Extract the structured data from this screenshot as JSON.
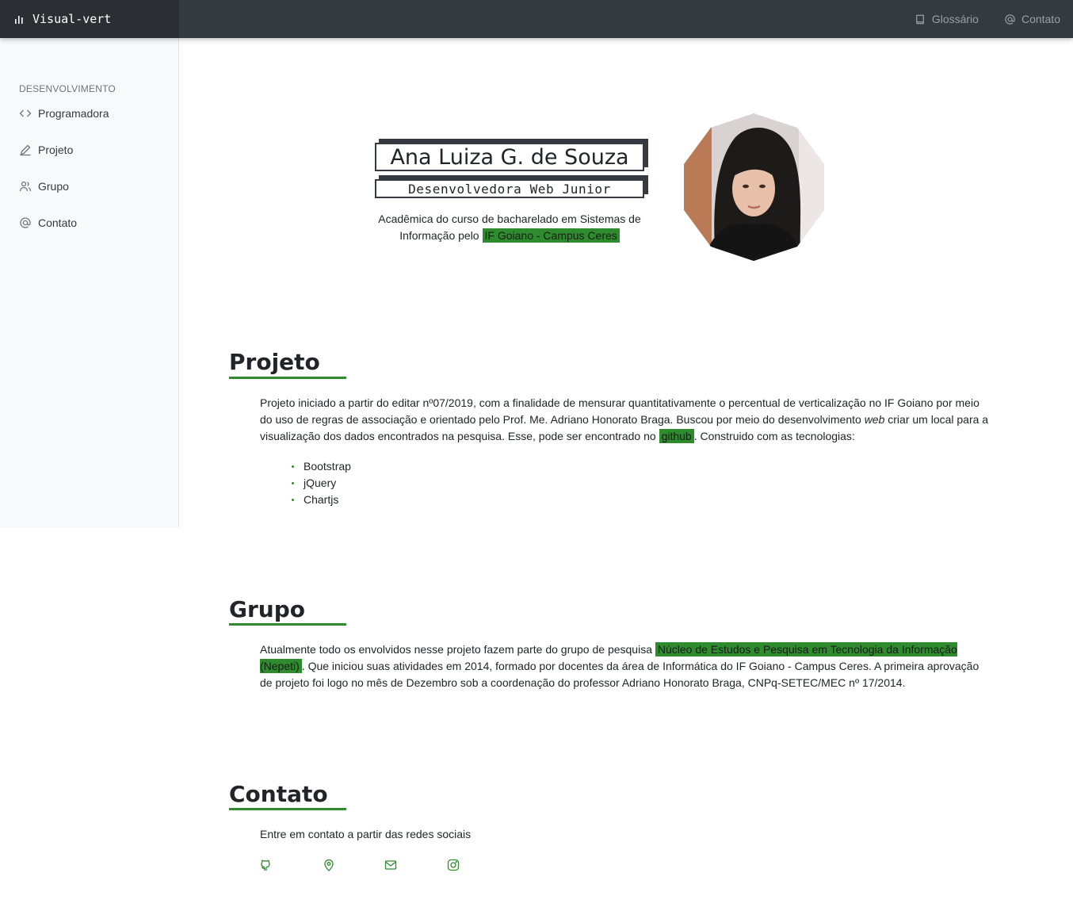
{
  "brand": {
    "name": "Visual-vert",
    "icon": "bar-chart-icon"
  },
  "topnav": [
    {
      "label": "Glossário",
      "icon": "book-icon"
    },
    {
      "label": "Contato",
      "icon": "at-icon"
    }
  ],
  "sidebar": {
    "heading": "DESENVOLVIMENTO",
    "items": [
      {
        "label": "Programadora",
        "icon": "code-icon"
      },
      {
        "label": "Projeto",
        "icon": "pencil-icon"
      },
      {
        "label": "Grupo",
        "icon": "users-icon"
      },
      {
        "label": "Contato",
        "icon": "at-icon"
      }
    ]
  },
  "hero": {
    "name": "Ana Luiza G. de Souza",
    "role": "Desenvolvedora Web Junior",
    "intro_text": "Acadêmica do curso de bacharelado em Sistemas de Informação pelo",
    "intro_link": "IF Goiano - Campus Ceres"
  },
  "projeto": {
    "title": "Projeto",
    "text_1": "Projeto iniciado a partir do editar nº07/2019, com a finalidade de mensurar quantitativamente o percentual de verticalização no IF Goiano por meio do uso de regras de associação e orientado pelo Prof. Me. Adriano Honorato Braga. Buscou por meio do desenvolvimento",
    "text_em": "web",
    "text_2": "criar um local para a visualização dos dados encontrados na pesquisa. Esse, pode ser encontrado no",
    "link": "github",
    "text_3": ". Construido com as tecnologias:",
    "technologies": [
      "Bootstrap",
      "jQuery",
      "Chartjs"
    ]
  },
  "grupo": {
    "title": "Grupo",
    "text_1": "Atualmente todo os envolvidos nesse projeto fazem parte do grupo de pesquisa",
    "link": "Núcleo de Estudos e Pesquisa em Tecnologia da Informação (Nepeti)",
    "text_2": ". Que iniciou suas atividades em 2014, formado por docentes da área de Informática do IF Goiano - Campus Ceres. A primeira aprovação de projeto foi logo no mês de Dezembro sob a coordenação do professor Adriano Honorato Braga, CNPq-SETEC/MEC nº 17/2014."
  },
  "contato": {
    "title": "Contato",
    "text": "Entre em contato a partir das redes sociais",
    "socials": [
      "github-icon",
      "map-pin-icon",
      "mail-icon",
      "instagram-icon"
    ]
  },
  "colors": {
    "accent": "#2e8b2e",
    "topbar": "#343a40",
    "sidebar": "#f8f9fa"
  }
}
